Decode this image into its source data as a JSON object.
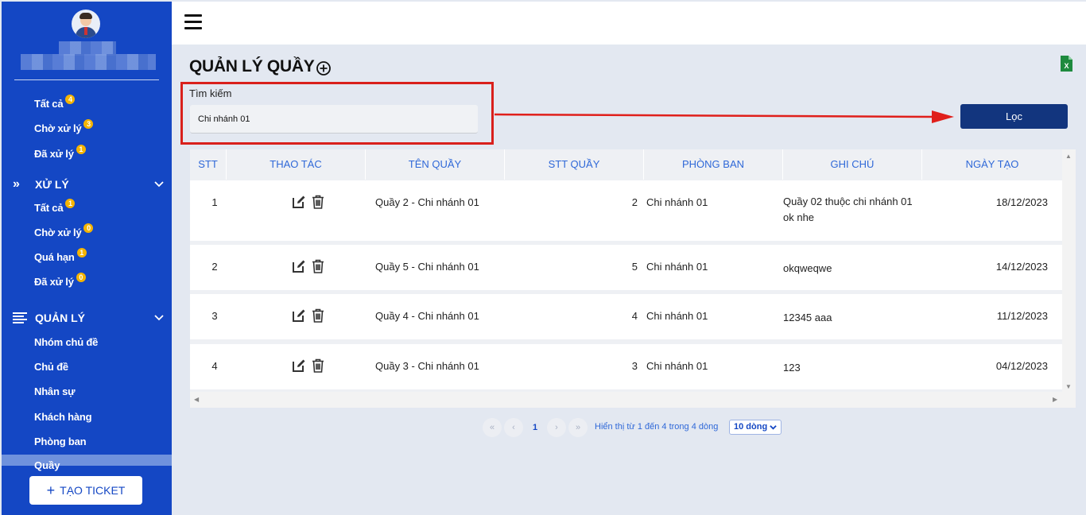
{
  "sidebar": {
    "top_items": [
      {
        "label": "Tất cả",
        "badge": "4"
      },
      {
        "label": "Chờ xử lý",
        "badge": "3"
      },
      {
        "label": "Đã xử lý",
        "badge": "1"
      }
    ],
    "section_process": {
      "title": "XỬ LÝ",
      "icon": "double-chevron-right-icon"
    },
    "process_items": [
      {
        "label": "Tất cả",
        "badge": "1"
      },
      {
        "label": "Chờ xử lý",
        "badge": "0"
      },
      {
        "label": "Quá hạn",
        "badge": "1"
      },
      {
        "label": "Đã xử lý",
        "badge": "0"
      }
    ],
    "section_manage": {
      "title": "QUẢN LÝ",
      "icon": "list-icon"
    },
    "manage_items": [
      "Nhóm chủ đề",
      "Chủ đề",
      "Nhân sự",
      "Khách hàng",
      "Phòng ban",
      "Quầy"
    ],
    "create_button": "TẠO TICKET"
  },
  "page": {
    "title": "QUẢN LÝ QUẦY",
    "search_label": "Tìm kiếm",
    "search_value": "Chi nhánh 01",
    "filter_button": "Lọc"
  },
  "table": {
    "headers": [
      "STT",
      "THAO TÁC",
      "TÊN QUẦY",
      "STT QUẦY",
      "PHÒNG BAN",
      "GHI CHÚ",
      "NGÀY TẠO"
    ],
    "rows": [
      {
        "stt": "1",
        "name": "Quầy 2 - Chi nhánh 01",
        "num": "2",
        "dept": "Chi nhánh 01",
        "note": "Quầy 02 thuộc chi nhánh 01 ok nhe",
        "date": "18/12/2023"
      },
      {
        "stt": "2",
        "name": "Quầy 5 - Chi nhánh 01",
        "num": "5",
        "dept": "Chi nhánh 01",
        "note": "okqweqwe",
        "date": "14/12/2023"
      },
      {
        "stt": "3",
        "name": "Quầy 4 - Chi nhánh 01",
        "num": "4",
        "dept": "Chi nhánh 01",
        "note": "12345 aaa",
        "date": "11/12/2023"
      },
      {
        "stt": "4",
        "name": "Quầy 3 - Chi nhánh 01",
        "num": "3",
        "dept": "Chi nhánh 01",
        "note": "123",
        "date": "04/12/2023"
      }
    ]
  },
  "pagination": {
    "first": "«",
    "prev": "‹",
    "current": "1",
    "next": "›",
    "last": "»",
    "info": "Hiển thị từ 1 đến 4 trong 4 dòng",
    "page_size": "10 dòng"
  },
  "colors": {
    "sidebar": "#1447c4",
    "accent": "#12357e",
    "highlight": "#d9201c",
    "header_text": "#2f68d8"
  }
}
